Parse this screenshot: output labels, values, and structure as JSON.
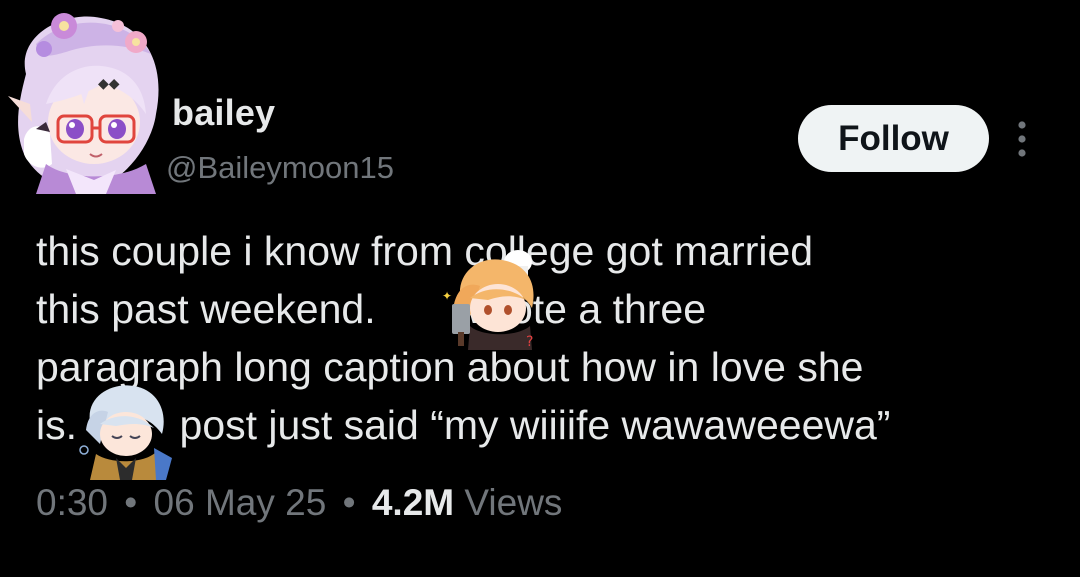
{
  "author": {
    "display_name": "bailey",
    "handle": "@Baileymoon15"
  },
  "actions": {
    "follow_label": "Follow",
    "more_icon": "more-vertical-icon"
  },
  "tweet": {
    "lines": [
      "this couple i know from college got married",
      "this past weekend.        wrote a three",
      "paragraph long caption about how in love she",
      "is.         post just said “my wiiiife wawaweeewa”"
    ]
  },
  "meta": {
    "time": "0:30",
    "separator": "•",
    "date": "06 May 25",
    "views_count": "4.2M",
    "views_label": "Views"
  },
  "colors": {
    "background": "#000000",
    "text_primary": "#e7e9ea",
    "text_secondary": "#71767b",
    "follow_bg": "#eff3f4",
    "follow_text": "#0f1419"
  },
  "stickers": [
    "chef-character-sticker",
    "sleeping-character-sticker"
  ]
}
